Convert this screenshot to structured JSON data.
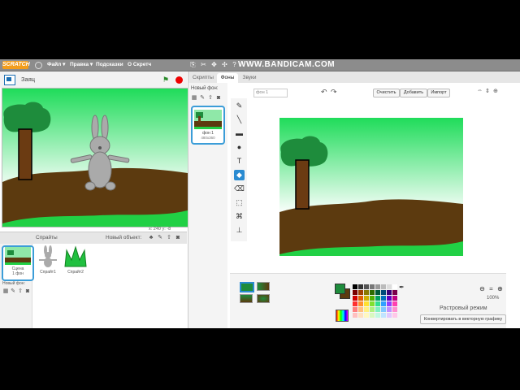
{
  "app": {
    "logo": "SCRATCH",
    "watermark": "WWW.BANDICAM.COM"
  },
  "menu": {
    "file": "Файл ▾",
    "edit": "Правка ▾",
    "tips": "Подсказки",
    "about": "О Скретч"
  },
  "stage_bar": {
    "sprite_name": "Заяц"
  },
  "coords": "x: 240  y: -8",
  "sprites_panel": {
    "title": "Спрайты",
    "new_object": "Новый объект:"
  },
  "stage_thumb": {
    "label": "Сцена",
    "sub": "1 фон"
  },
  "new_backdrop_left": "Новый фон:",
  "sprites": [
    {
      "label": "Спрайт1"
    },
    {
      "label": "Спрайт2"
    }
  ],
  "tabs": [
    "Скрипты",
    "Фоны",
    "Звуки"
  ],
  "backdrops_panel": {
    "title": "Новый фон:",
    "item_label": "фон 1",
    "item_size": "480x360"
  },
  "editor": {
    "name_value": "фон 1",
    "clear": "Очистить",
    "add": "Добавить",
    "import": "Импорт",
    "bitmap_mode": "Растровый режим",
    "convert": "Конвертировать в векторную графику",
    "zoom": "100%"
  },
  "colors": {
    "menubar": "#8c8c8c",
    "selection": "#2a8bd1",
    "ground": "#5c3a0f",
    "grass": "#21d045",
    "tree_leaves": "#1e8c3c",
    "trunk": "#6b3b12"
  },
  "palette": [
    "#000000",
    "#333333",
    "#555555",
    "#777777",
    "#999999",
    "#bbbbbb",
    "#dddddd",
    "#ffffff",
    "#7a0000",
    "#a04000",
    "#8a7a00",
    "#2e6b00",
    "#005a3a",
    "#004a7a",
    "#3a007a",
    "#7a004a",
    "#d00000",
    "#e06000",
    "#d0b000",
    "#50b000",
    "#00a060",
    "#0070c0",
    "#6000c0",
    "#c00080",
    "#ff3030",
    "#ff9030",
    "#ffe030",
    "#80e030",
    "#30e090",
    "#30a0ff",
    "#9040ff",
    "#ff40b0",
    "#ff8080",
    "#ffc080",
    "#fff080",
    "#b0f080",
    "#80f0c0",
    "#80c8ff",
    "#c090ff",
    "#ff90d0",
    "#ffc0c0",
    "#ffe0c0",
    "#fff8c0",
    "#d8f8c0",
    "#c0f8e0",
    "#c0e4ff",
    "#e0c8ff",
    "#ffc8e8"
  ]
}
